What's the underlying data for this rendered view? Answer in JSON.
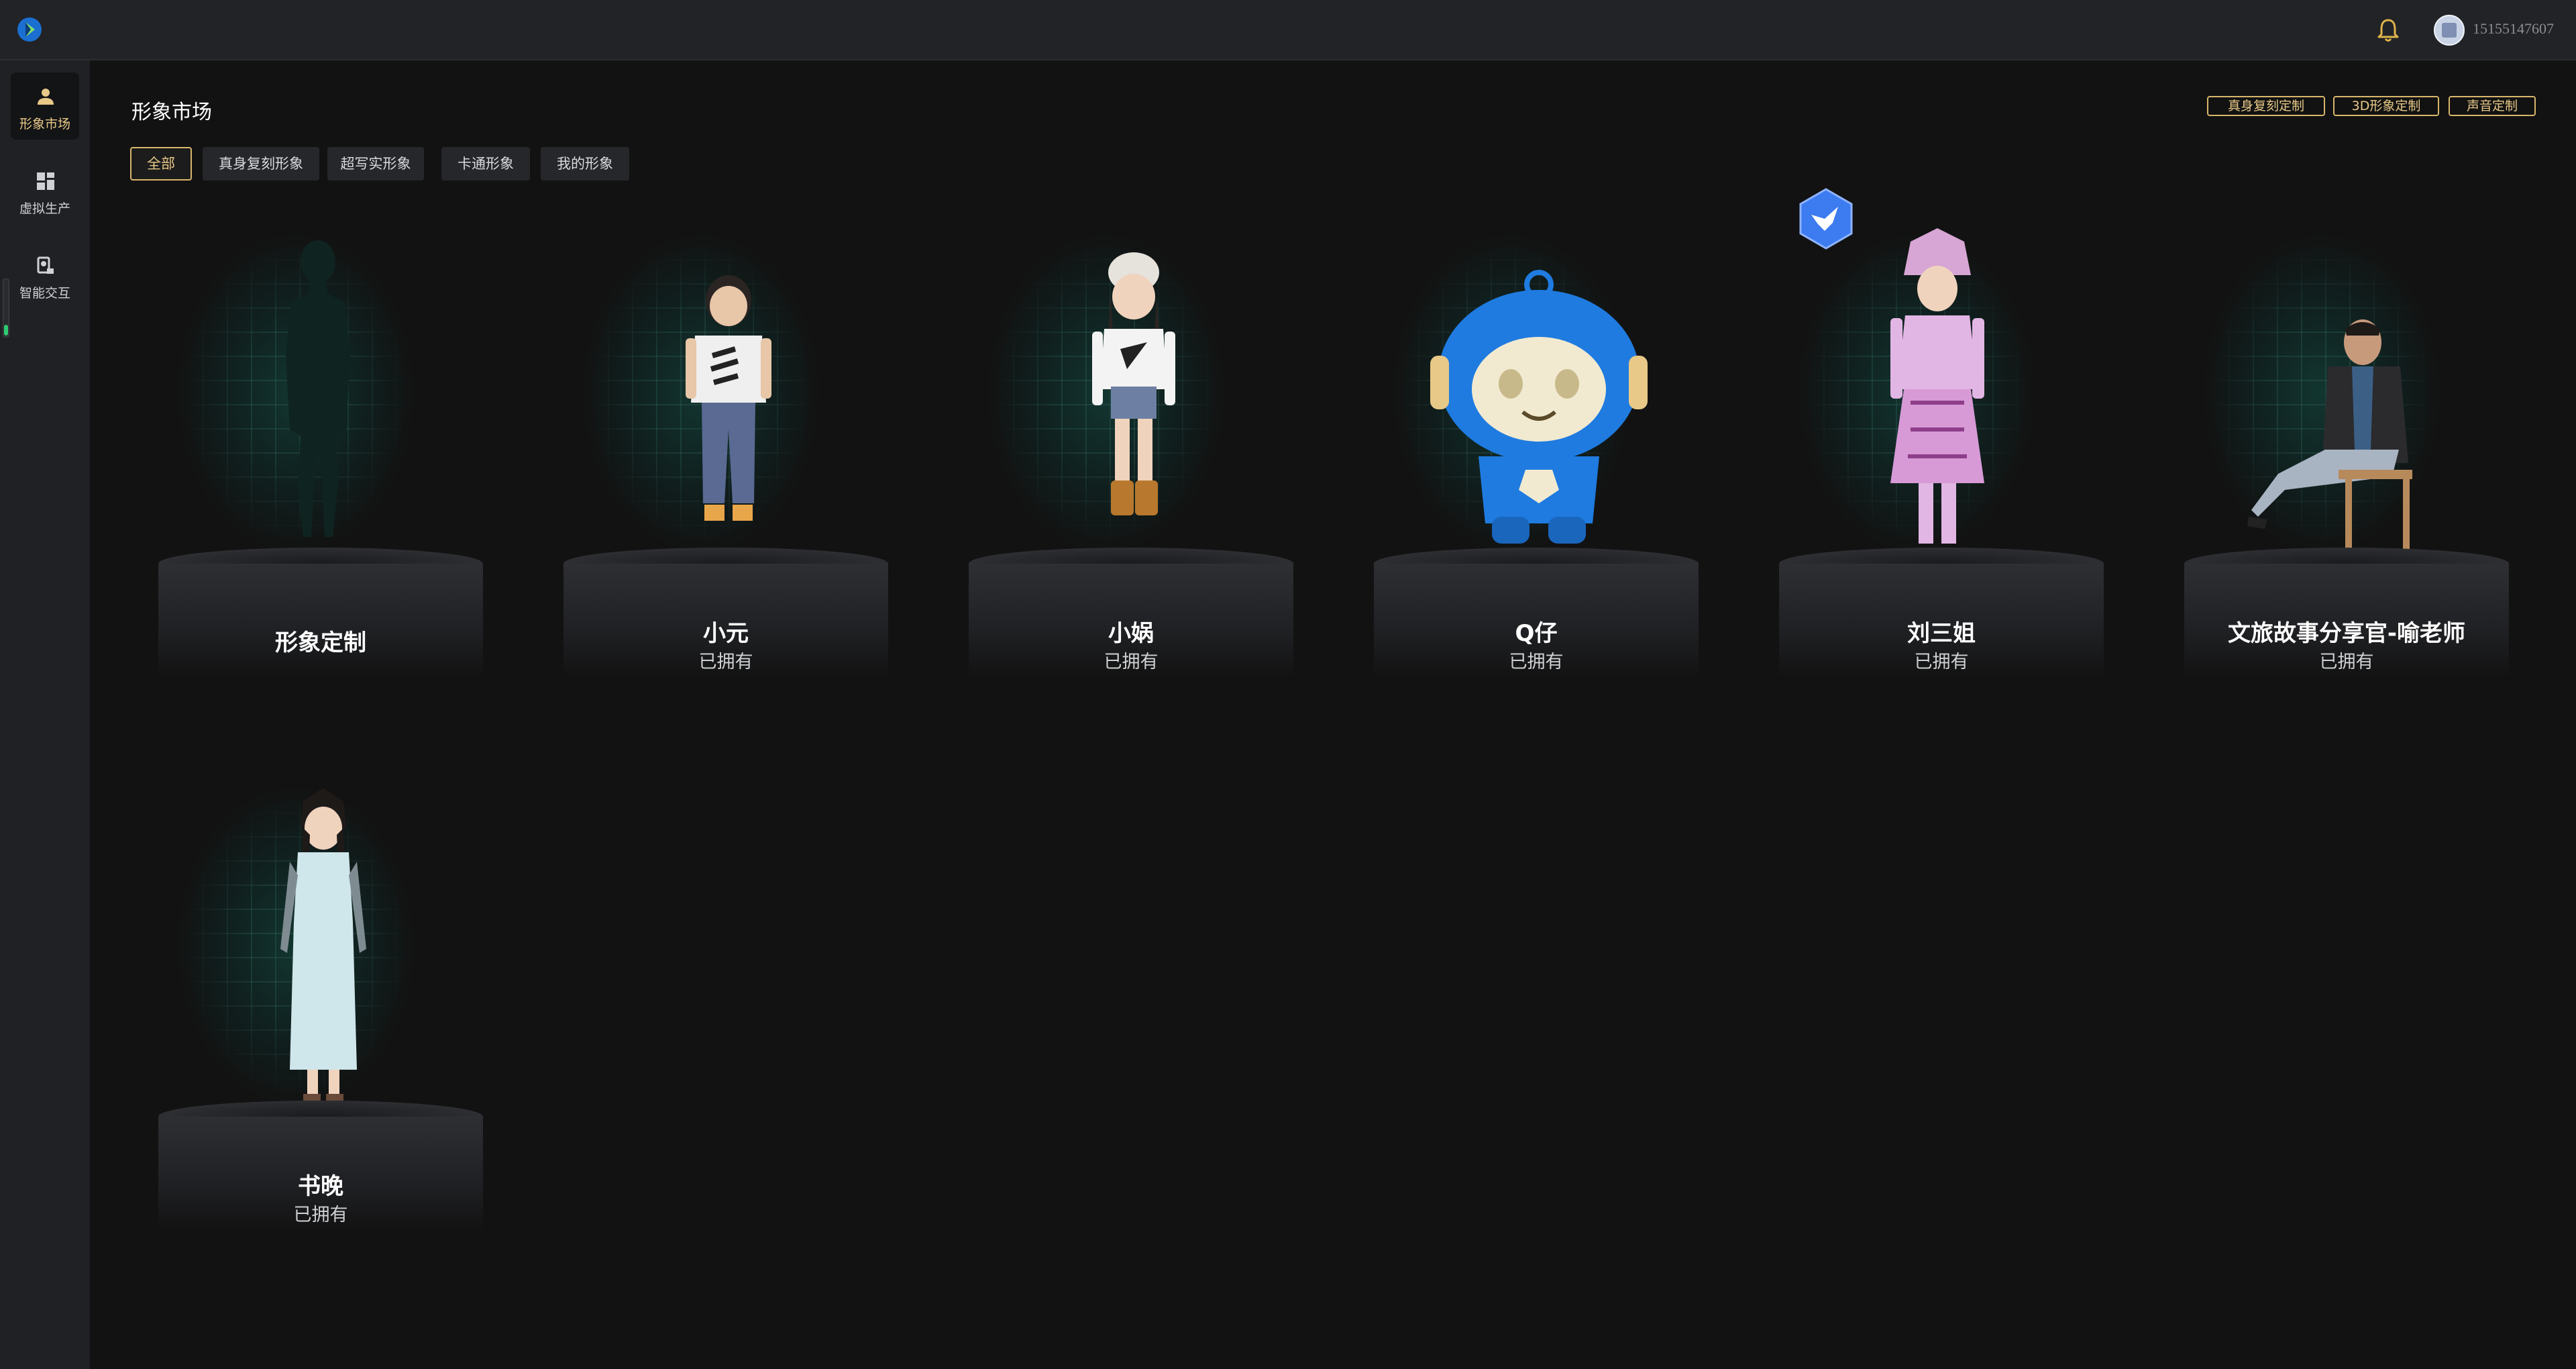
{
  "topbar": {
    "user_id": "15155147607",
    "logo_icon": "app-logo-icon",
    "bell_icon": "bell-icon"
  },
  "sidebar": {
    "items": [
      {
        "label": "形象市场",
        "icon": "person-icon",
        "active": true
      },
      {
        "label": "虚拟生产",
        "icon": "grid-icon",
        "active": false
      },
      {
        "label": "智能交互",
        "icon": "interaction-icon",
        "active": false
      }
    ]
  },
  "header": {
    "title": "形象市场",
    "buttons": [
      "真身复刻定制",
      "3D形象定制",
      "声音定制"
    ]
  },
  "filters": {
    "items": [
      "全部",
      "真身复刻形象",
      "超写实形象",
      "卡通形象",
      "我的形象"
    ],
    "active": "全部"
  },
  "cards": [
    {
      "name": "形象定制",
      "status": ""
    },
    {
      "name": "小元",
      "status": "已拥有"
    },
    {
      "name": "小娲",
      "status": "已拥有"
    },
    {
      "name": "Q仔",
      "status": "已拥有"
    },
    {
      "name": "刘三姐",
      "status": "已拥有"
    },
    {
      "name": "文旅故事分享官-喻老师",
      "status": "已拥有"
    },
    {
      "name": "书晚",
      "status": "已拥有"
    }
  ],
  "colors": {
    "accent": "#e8c987",
    "background": "#121212",
    "sidebar": "#202124"
  }
}
